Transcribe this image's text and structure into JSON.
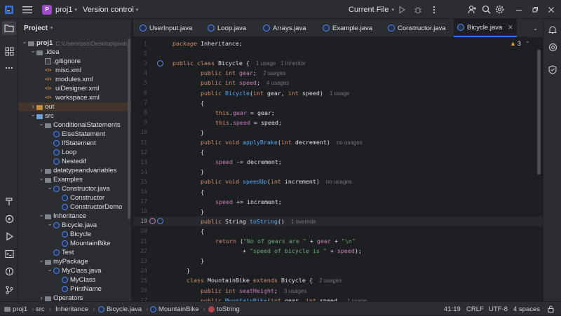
{
  "titlebar": {
    "project_badge": "P",
    "project_name": "proj1",
    "vcs": "Version control",
    "run_config": "Current File"
  },
  "project_panel": {
    "title": "Project",
    "tree": [
      {
        "label": "proj1",
        "path": "C:\\Users\\sss\\Desktop\\java\\",
        "icon": "folder",
        "arrow": "down",
        "bold": true
      },
      {
        "label": ".idea",
        "icon": "folder",
        "arrow": "down"
      },
      {
        "label": ".gitignore",
        "icon": "file"
      },
      {
        "label": "misc.xml",
        "icon": "xml"
      },
      {
        "label": "modules.xml",
        "icon": "xml"
      },
      {
        "label": "uiDesigner.xml",
        "icon": "xml"
      },
      {
        "label": "workspace.xml",
        "icon": "xml"
      },
      {
        "label": "out",
        "icon": "folder-out",
        "arrow": "right",
        "highlight": true
      },
      {
        "label": "src",
        "icon": "folder-src",
        "arrow": "down"
      },
      {
        "label": "ConditionalStatements",
        "icon": "folder",
        "arrow": "down"
      },
      {
        "label": "ElseStatement",
        "icon": "class"
      },
      {
        "label": "IfStatement",
        "icon": "class"
      },
      {
        "label": "Loop",
        "icon": "class"
      },
      {
        "label": "Nestedif",
        "icon": "class"
      },
      {
        "label": "datatypeandvariables",
        "icon": "folder",
        "arrow": "right"
      },
      {
        "label": "Examples",
        "icon": "folder",
        "arrow": "down"
      },
      {
        "label": "Constructor.java",
        "icon": "class",
        "arrow": "down"
      },
      {
        "label": "Constructor",
        "icon": "class"
      },
      {
        "label": "ConstructorDemo",
        "icon": "class"
      },
      {
        "label": "Inheritance",
        "icon": "folder",
        "arrow": "down"
      },
      {
        "label": "Bicycle.java",
        "icon": "class",
        "arrow": "down"
      },
      {
        "label": "Bicycle",
        "icon": "class"
      },
      {
        "label": "MountainBike",
        "icon": "class"
      },
      {
        "label": "Test",
        "icon": "class"
      },
      {
        "label": "myPackage",
        "icon": "folder",
        "arrow": "down"
      },
      {
        "label": "MyClass.java",
        "icon": "class",
        "arrow": "down"
      },
      {
        "label": "MyClass",
        "icon": "class"
      },
      {
        "label": "PrintName",
        "icon": "class"
      },
      {
        "label": "Operators",
        "icon": "folder",
        "arrow": "right"
      }
    ]
  },
  "tabs": [
    {
      "label": "UserInput.java"
    },
    {
      "label": "Loop.java"
    },
    {
      "label": "Arrays.java"
    },
    {
      "label": "Example.java"
    },
    {
      "label": "Constructor.java"
    },
    {
      "label": "Bicycle.java",
      "active": true
    }
  ],
  "editor": {
    "warnings_count": "3",
    "lines": [
      {
        "n": "1"
      },
      {
        "n": "2"
      },
      {
        "n": "3"
      },
      {
        "n": "4"
      },
      {
        "n": "5"
      },
      {
        "n": "6"
      },
      {
        "n": "7"
      },
      {
        "n": "8"
      },
      {
        "n": "9"
      },
      {
        "n": "10"
      },
      {
        "n": "11"
      },
      {
        "n": "12"
      },
      {
        "n": "13"
      },
      {
        "n": "14"
      },
      {
        "n": "15"
      },
      {
        "n": "16"
      },
      {
        "n": "17"
      },
      {
        "n": "18"
      },
      {
        "n": "19"
      },
      {
        "n": "20"
      },
      {
        "n": "21"
      },
      {
        "n": "22"
      },
      {
        "n": "23"
      },
      {
        "n": "24"
      },
      {
        "n": "25"
      },
      {
        "n": "26"
      },
      {
        "n": "27"
      }
    ],
    "code": {
      "l1": [
        "package",
        " Inheritance;"
      ],
      "l3": [
        "public class ",
        "Bicycle",
        " {",
        "1 usage   1 inheritor"
      ],
      "l4": [
        "public int ",
        "gear",
        ";",
        "2 usages"
      ],
      "l5": [
        "public int ",
        "speed",
        ";",
        "4 usages"
      ],
      "l6": [
        "public ",
        "Bicycle",
        "(",
        "int",
        " gear, ",
        "int",
        " speed)",
        "1 usage"
      ],
      "l7": "{",
      "l8": [
        "this",
        ".",
        "gear",
        " = gear;"
      ],
      "l9": [
        "this",
        ".",
        "speed",
        " = speed;"
      ],
      "l10": "}",
      "l11": [
        "public void ",
        "applyBrake",
        "(",
        "int",
        " decrement)",
        "no usages"
      ],
      "l12": "{",
      "l13": [
        "speed",
        " -= decrement;"
      ],
      "l14": "}",
      "l15": [
        "public void ",
        "speedUp",
        "(",
        "int",
        " increment)",
        "no usages"
      ],
      "l16": "{",
      "l17": [
        "speed",
        " += increment;"
      ],
      "l18": "}",
      "l19": [
        "public ",
        "String ",
        "toString",
        "()",
        "1 override"
      ],
      "l20": "{",
      "l21": [
        "return ",
        "(",
        "\"No of gears are \"",
        " + ",
        "gear",
        " + ",
        "\"\\n\""
      ],
      "l22": [
        "+ ",
        "\"speed of bicycle is \"",
        " + ",
        "speed",
        ");"
      ],
      "l23": "}",
      "l24": "}",
      "l25": [
        "class ",
        "MountainBike ",
        "extends ",
        "Bicycle",
        " {",
        "2 usages"
      ],
      "l26": [
        "public int ",
        "seatHeight",
        ";",
        "3 usages"
      ],
      "l27": [
        "public ",
        "MountainBike",
        "(",
        "int",
        " gear, ",
        "int",
        " speed,",
        "1 usage"
      ]
    }
  },
  "statusbar": {
    "breadcrumbs": [
      "proj1",
      "src",
      "Inheritance",
      "Bicycle.java",
      "MountainBike",
      "toString"
    ],
    "position": "41:19",
    "line_ending": "CRLF",
    "encoding": "UTF-8",
    "indent": "4 spaces"
  }
}
